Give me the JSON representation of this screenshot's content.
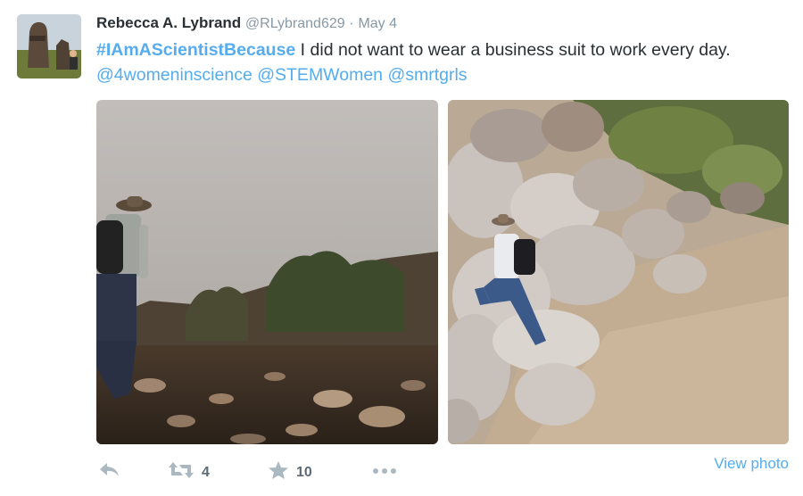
{
  "tweet": {
    "author_name": "Rebecca A. Lybrand",
    "author_handle": "@RLybrand629",
    "separator": "·",
    "date": "May 4",
    "hashtag": "#IAmAScientistBecause",
    "text": " I did not want to wear a business suit to work every day. ",
    "mentions": [
      "@4womeninscience",
      "@STEMWomen",
      "@smrtgrls"
    ]
  },
  "actions": {
    "reply_icon": "reply-icon",
    "retweet_icon": "retweet-icon",
    "retweet_count": "4",
    "favorite_icon": "star-icon",
    "favorite_count": "10",
    "more_icon": "more-dots-icon",
    "view_photo_label": "View photo"
  },
  "colors": {
    "link": "#55acee",
    "text": "#292f33",
    "muted": "#8899a6",
    "action_icon": "#aab8c2"
  }
}
